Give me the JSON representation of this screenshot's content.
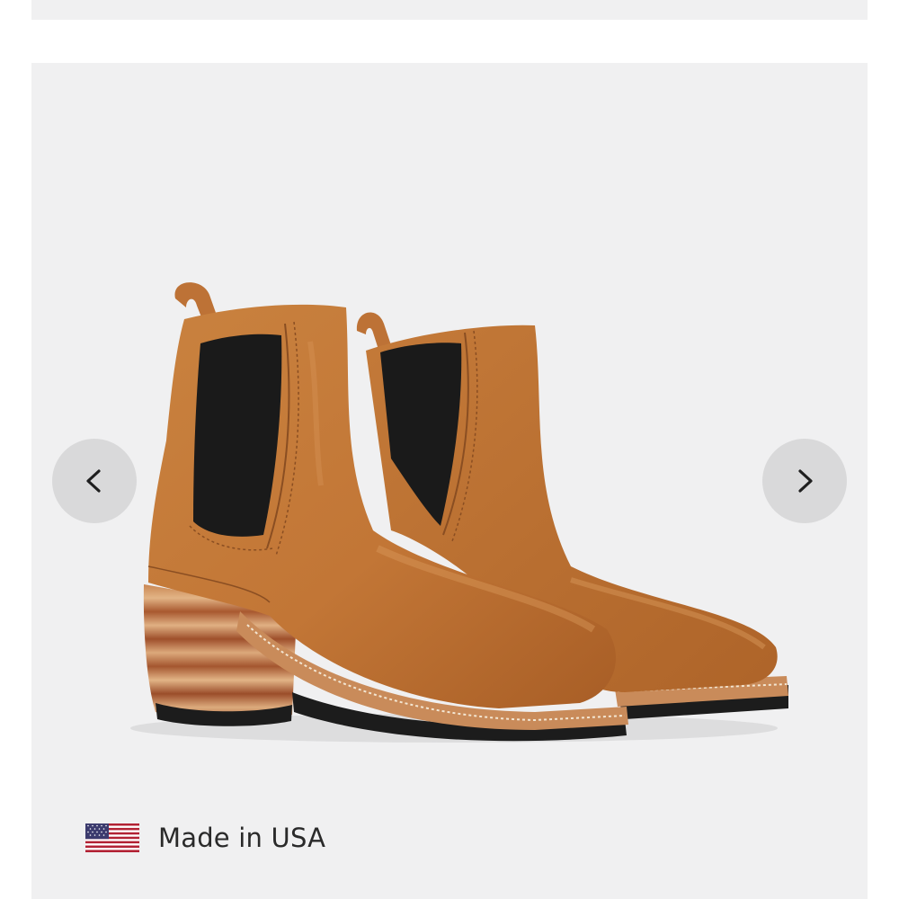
{
  "gallery": {
    "prev_icon": "chevron-left-icon",
    "next_icon": "chevron-right-icon",
    "image_icon": "chelsea-boots-image"
  },
  "badge": {
    "flag_icon": "us-flag-icon",
    "label": "Made in USA"
  },
  "colors": {
    "background": "#f0f0f1",
    "nav_button": "#d9d9da",
    "leather": "#c47a3c",
    "text": "#2a2a2a"
  }
}
